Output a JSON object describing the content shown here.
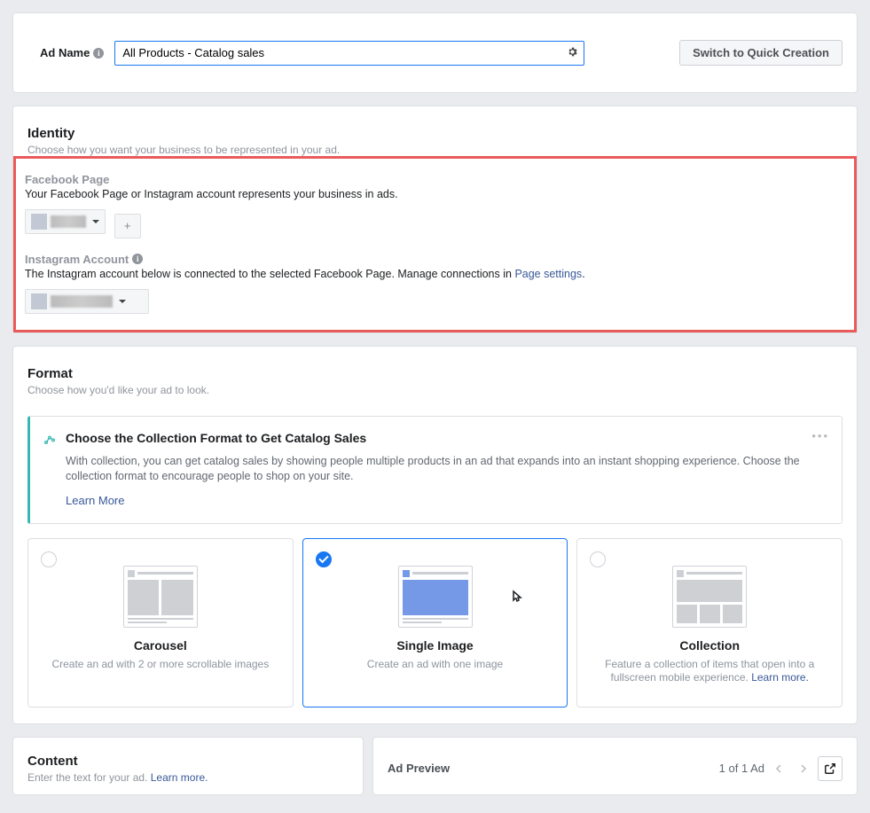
{
  "ad_name": {
    "label": "Ad Name",
    "value": "All Products - Catalog sales"
  },
  "switch_button": "Switch to Quick Creation",
  "identity": {
    "title": "Identity",
    "sub": "Choose how you want your business to be represented in your ad.",
    "fb_page_label": "Facebook Page",
    "fb_page_desc": "Your Facebook Page or Instagram account represents your business in ads.",
    "ig_label": "Instagram Account",
    "ig_desc_pre": "The Instagram account below is connected to the selected Facebook Page. Manage connections in ",
    "ig_link": "Page settings",
    "ig_desc_post": "."
  },
  "format": {
    "title": "Format",
    "sub": "Choose how you'd like your ad to look.",
    "tip": {
      "heading": "Choose the Collection Format to Get Catalog Sales",
      "body": "With collection, you can get catalog sales by showing people multiple products in an ad that expands into an instant shopping experience. Choose the collection format to encourage people to shop on your site.",
      "learn_more": "Learn More"
    },
    "options": [
      {
        "title": "Carousel",
        "desc": "Create an ad with 2 or more scrollable images",
        "selected": false
      },
      {
        "title": "Single Image",
        "desc": "Create an ad with one image",
        "selected": true
      },
      {
        "title": "Collection",
        "desc_pre": "Feature a collection of items that open into a fullscreen mobile experience. ",
        "learn_more": "Learn more.",
        "selected": false
      }
    ]
  },
  "content": {
    "title": "Content",
    "sub_pre": "Enter the text for your ad. ",
    "learn_more": "Learn more."
  },
  "preview": {
    "title": "Ad Preview",
    "counter": "1 of 1 Ad"
  }
}
